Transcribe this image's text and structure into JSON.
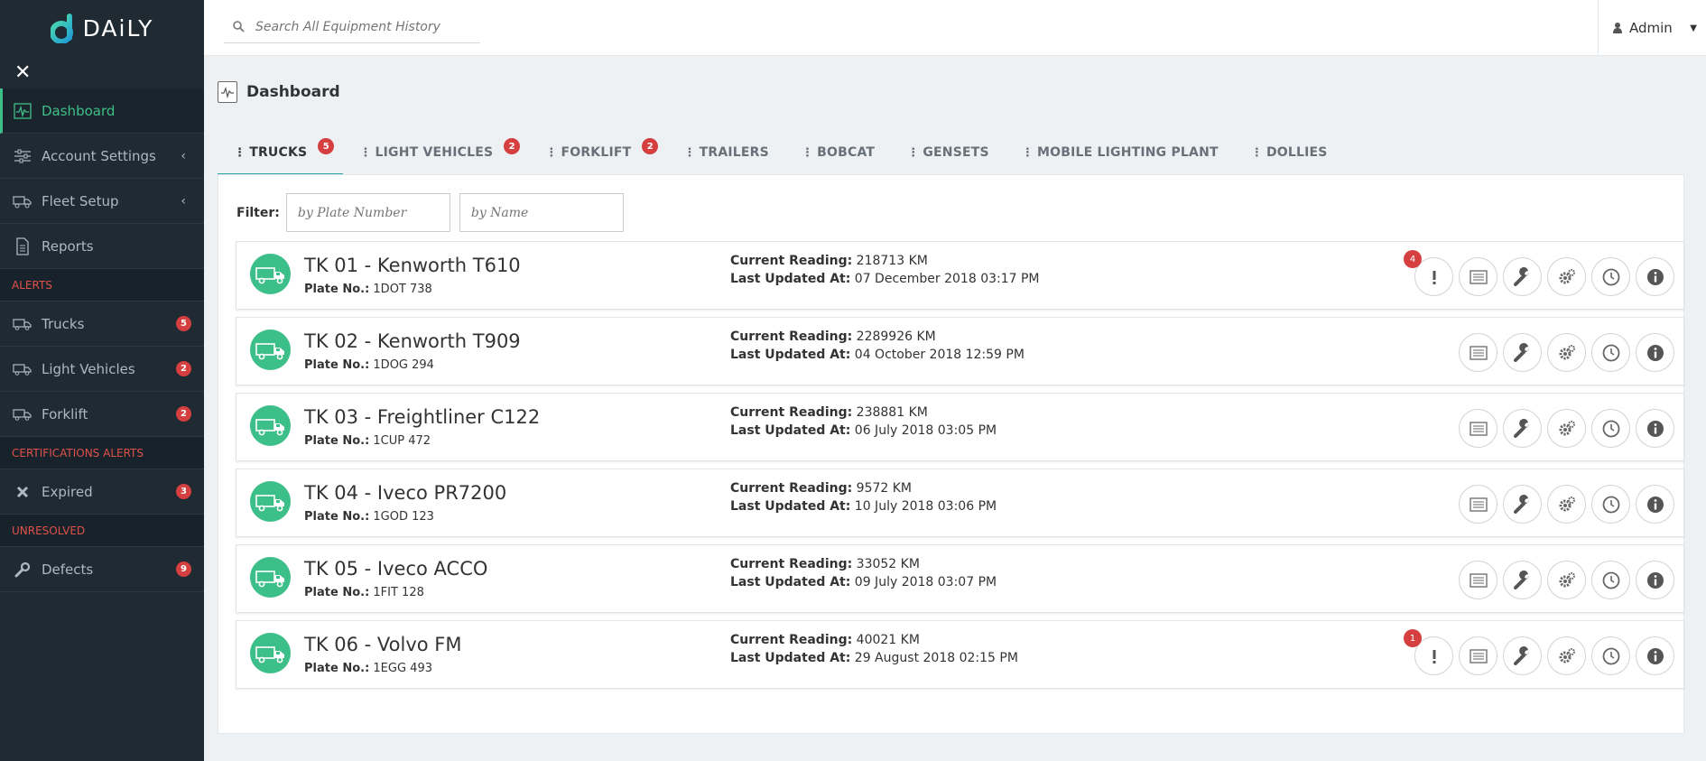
{
  "brand": {
    "name": "DAiLY"
  },
  "colors": {
    "accent": "#3fbf88",
    "sidebar": "#1f2a33",
    "badge": "#d53f3f",
    "tab_underline": "#2aa5a0"
  },
  "sidebar": {
    "close_icon": "close-icon",
    "items": [
      {
        "label": "Dashboard",
        "icon": "dashboard-icon",
        "active": true
      },
      {
        "label": "Account Settings",
        "icon": "sliders-icon",
        "chevron": "‹"
      },
      {
        "label": "Fleet Setup",
        "icon": "truck-gear-icon",
        "chevron": "‹"
      },
      {
        "label": "Reports",
        "icon": "document-icon"
      }
    ],
    "alerts_header": "ALERTS",
    "alerts": [
      {
        "label": "Trucks",
        "count": "5"
      },
      {
        "label": "Light Vehicles",
        "count": "2"
      },
      {
        "label": "Forklift",
        "count": "2"
      }
    ],
    "cert_header": "CERTIFICATIONS ALERTS",
    "cert": [
      {
        "label": "Expired",
        "count": "3"
      }
    ],
    "unresolved_header": "UNRESOLVED",
    "unresolved": [
      {
        "label": "Defects",
        "count": "9"
      }
    ]
  },
  "topbar": {
    "search_placeholder": "Search All Equipment History",
    "user": "Admin"
  },
  "page": {
    "title": "Dashboard"
  },
  "tabs": [
    {
      "label": "TRUCKS",
      "badge": "5",
      "active": true
    },
    {
      "label": "LIGHT VEHICLES",
      "badge": "2"
    },
    {
      "label": "FORKLIFT",
      "badge": "2"
    },
    {
      "label": "TRAILERS"
    },
    {
      "label": "BOBCAT"
    },
    {
      "label": "GENSETS"
    },
    {
      "label": "MOBILE LIGHTING PLANT"
    },
    {
      "label": "DOLLIES"
    }
  ],
  "filter": {
    "label": "Filter:",
    "plate_placeholder": "by Plate Number",
    "name_placeholder": "by Name"
  },
  "labels": {
    "plate": "Plate No.:",
    "reading": "Current Reading:",
    "updated": "Last Updated At:"
  },
  "vehicles": [
    {
      "title": "TK 01 - Kenworth T610",
      "plate": "1DOT 738",
      "reading": "218713 KM",
      "updated": "07 December 2018 03:17 PM",
      "alerts": "4"
    },
    {
      "title": "TK 02 - Kenworth T909",
      "plate": "1DOG 294",
      "reading": "2289926 KM",
      "updated": "04 October 2018 12:59 PM",
      "alerts": null
    },
    {
      "title": "TK 03 - Freightliner C122",
      "plate": "1CUP 472",
      "reading": "238881 KM",
      "updated": "06 July 2018 03:05 PM",
      "alerts": null
    },
    {
      "title": "TK 04 - Iveco PR7200",
      "plate": "1GOD 123",
      "reading": "9572 KM",
      "updated": "10 July 2018 03:06 PM",
      "alerts": null
    },
    {
      "title": "TK 05 - Iveco ACCO",
      "plate": "1FIT 128",
      "reading": "33052 KM",
      "updated": "09 July 2018 03:07 PM",
      "alerts": null
    },
    {
      "title": "TK 06 - Volvo FM",
      "plate": "1EGG 493",
      "reading": "40021 KM",
      "updated": "29 August 2018 02:15 PM",
      "alerts": "1"
    }
  ],
  "row_actions": [
    "alert-icon",
    "list-icon",
    "wrench-icon",
    "gears-icon",
    "clock-icon",
    "info-icon"
  ]
}
